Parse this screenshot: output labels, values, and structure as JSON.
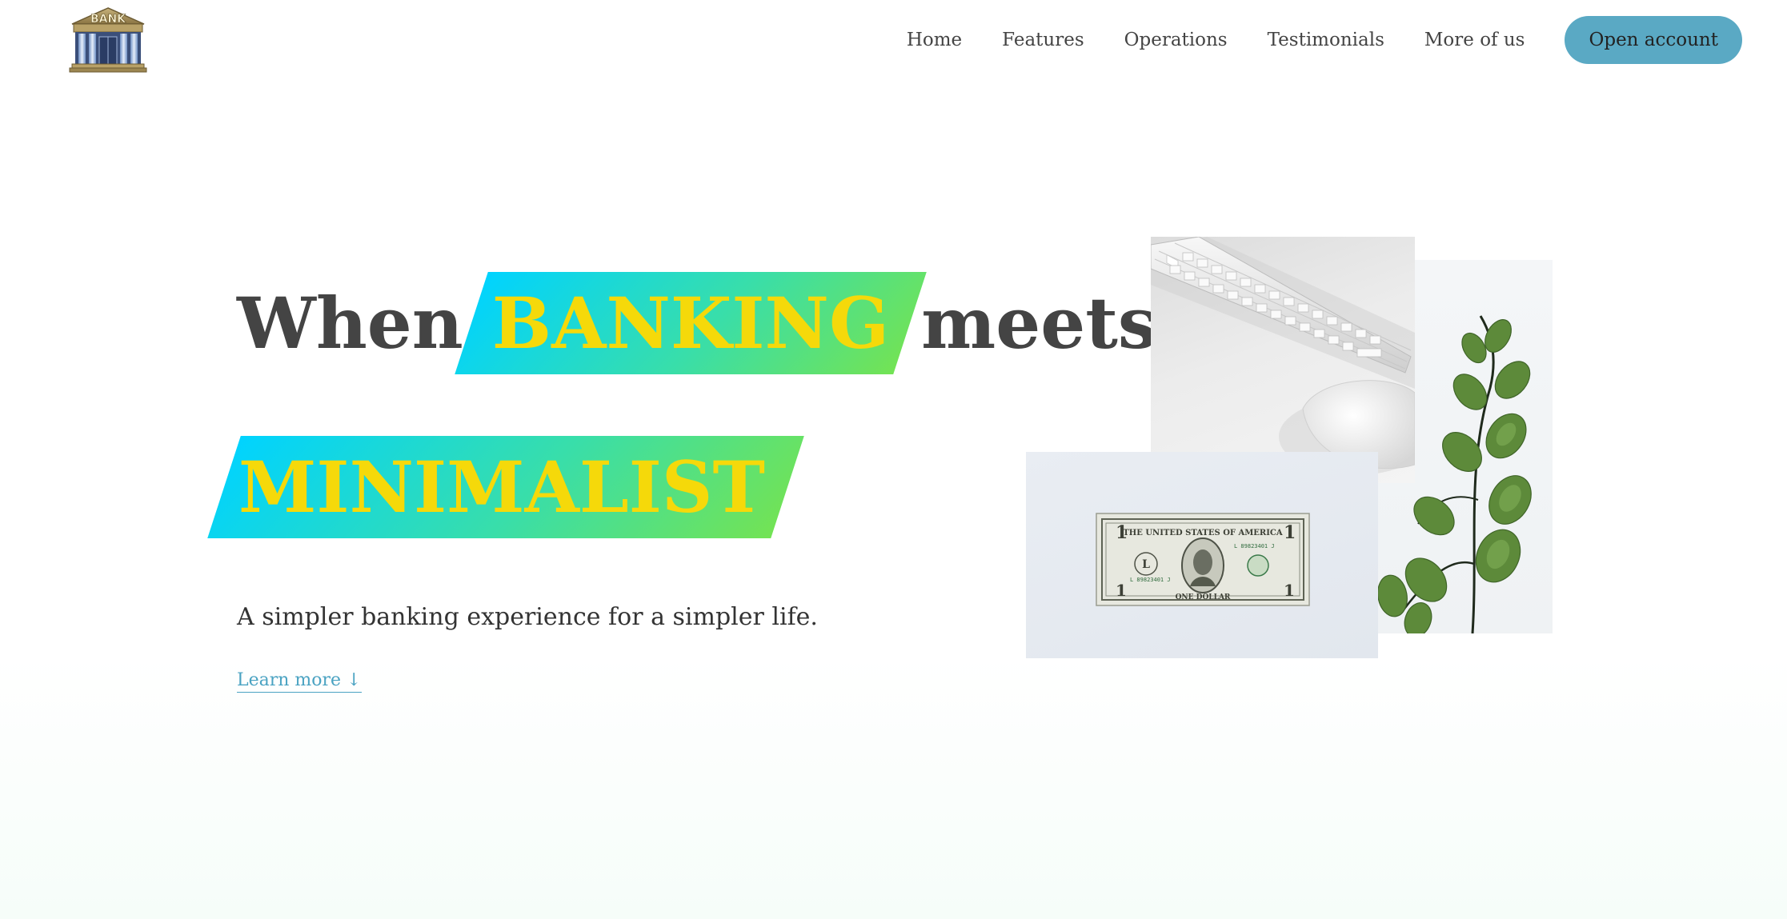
{
  "nav": {
    "logo_text": "BANK",
    "links": [
      "Home",
      "Features",
      "Operations",
      "Testimonials",
      "More of us"
    ],
    "cta_label": "Open account"
  },
  "hero": {
    "word_when": "When",
    "word_banking": "BANKING",
    "word_meets": "meets",
    "word_minimalist": "MINIMALIST",
    "subtitle": "A simpler banking experience for a simpler life.",
    "learn_more": "Learn more ↓"
  },
  "images": {
    "keyboard_icon": "keyboard-photo",
    "plant_icon": "plant-photo",
    "dollar_icon": "dollar-bill-photo",
    "dollar_text": "THE UNITED STATES OF AMERICA"
  },
  "colors": {
    "accent": "#5aa9c4",
    "highlight_text": "#f5d90a",
    "gradient_start": "#00d3ff",
    "gradient_end": "#73e354",
    "link": "#4aa3c2"
  }
}
